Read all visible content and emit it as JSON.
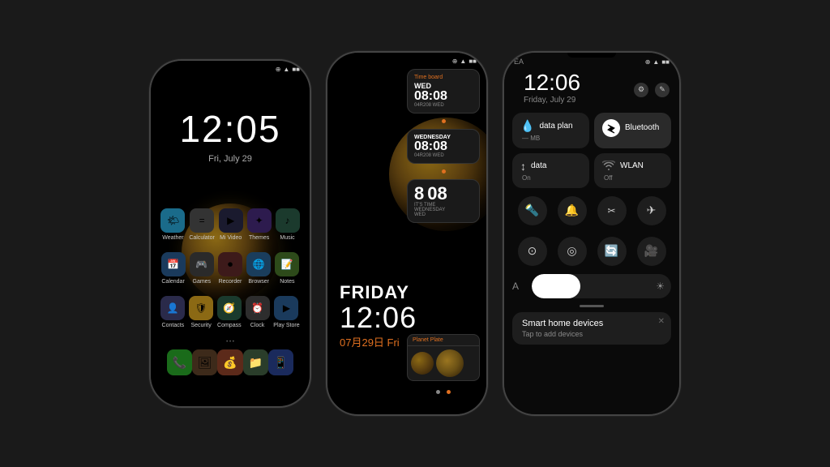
{
  "phone1": {
    "time": "12:05",
    "date": "Fri, July 29",
    "status": "⊕ ▲ ■■■■",
    "apps_row1": [
      {
        "label": "Weather",
        "color": "app-weather",
        "icon": "🌤"
      },
      {
        "label": "Calculator",
        "color": "app-calc",
        "icon": "="
      },
      {
        "label": "Mi Video",
        "color": "app-mivideo",
        "icon": "▶"
      },
      {
        "label": "Themes",
        "color": "app-themes",
        "icon": "✦"
      },
      {
        "label": "Music",
        "color": "app-music",
        "icon": "♪"
      }
    ],
    "apps_row2": [
      {
        "label": "Calendar",
        "color": "app-calendar",
        "icon": "📅"
      },
      {
        "label": "Games",
        "color": "app-games",
        "icon": "🎮"
      },
      {
        "label": "Recorder",
        "color": "app-recorder",
        "icon": "⏺"
      },
      {
        "label": "Browser",
        "color": "app-browser",
        "icon": "🌐"
      },
      {
        "label": "Notes",
        "color": "app-notes",
        "icon": "📝"
      }
    ],
    "apps_row3": [
      {
        "label": "Contacts",
        "color": "app-contacts",
        "icon": "👤"
      },
      {
        "label": "Security",
        "color": "app-security",
        "icon": "🛡"
      },
      {
        "label": "Compass",
        "color": "app-compass",
        "icon": "🧭"
      },
      {
        "label": "Clock",
        "color": "app-clock",
        "icon": "⏰"
      },
      {
        "label": "Play Store",
        "color": "app-play",
        "icon": "▶"
      }
    ],
    "dock": [
      {
        "icon": "📞",
        "color": "app-phone"
      },
      {
        "icon": "🖼",
        "color": "app-gallery"
      },
      {
        "icon": "💰",
        "color": "app-wallet"
      },
      {
        "icon": "📁",
        "color": "app-files"
      },
      {
        "icon": "📱",
        "color": "app-blue-app"
      }
    ]
  },
  "phone2": {
    "status": "⊕ ▲ ■■■■",
    "widget1": {
      "title": "Time board",
      "day": "WED",
      "time": "08:08",
      "sub": "04R208  WED"
    },
    "widget2": {
      "day": "WEDNESDAY",
      "time": "08:08",
      "sub": "04R208  WED"
    },
    "widget3": {
      "time1": "8",
      "time2": "08",
      "sub1": "IT'S TIME",
      "sub2": "WEDNESDAY",
      "sub3": "WED"
    },
    "big_day": "FRIDAY",
    "big_time": "12:06",
    "big_date": "07月29日  Fri",
    "planet_widget_title": "Planet Plate"
  },
  "phone3": {
    "ea_label": "EA",
    "status": "⊕ ▲ ■■■■",
    "time": "12:06",
    "date": "Friday, July 29",
    "tiles": [
      {
        "title": "data plan",
        "sub": "— MB",
        "icon": "💧",
        "active": false
      },
      {
        "title": "Bluetooth",
        "sub": "",
        "icon": "bluetooth",
        "active": true
      },
      {
        "title": "data",
        "sub": "On",
        "icon": "↕",
        "active": false
      },
      {
        "title": "WLAN",
        "sub": "Off",
        "icon": "wifi",
        "active": false
      }
    ],
    "quick_buttons": [
      "🔦",
      "🔔",
      "✂",
      "✈"
    ],
    "quick_row2": [
      "⊙",
      "◎",
      "🔄",
      "🎥"
    ],
    "brightness_label": "A",
    "smart_home": {
      "title": "Smart home devices",
      "sub": "Tap to add devices"
    }
  }
}
